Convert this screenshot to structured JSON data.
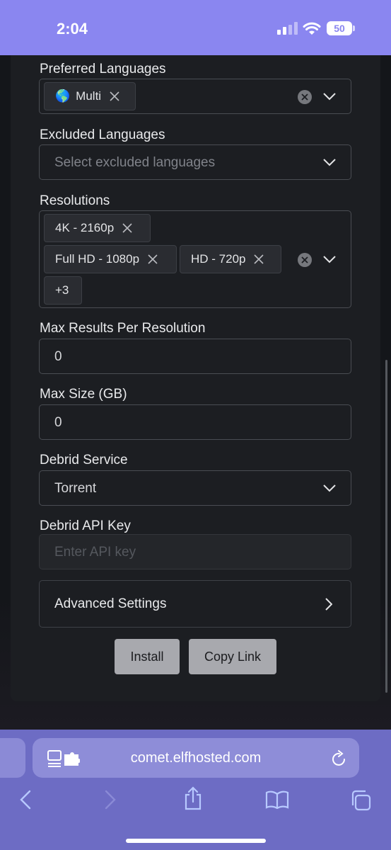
{
  "status_bar": {
    "time": "2:04",
    "battery": "50"
  },
  "form": {
    "preferred_languages": {
      "label": "Preferred Languages",
      "chips": [
        {
          "flag": "🌎",
          "label": "Multi"
        }
      ]
    },
    "excluded_languages": {
      "label": "Excluded Languages",
      "placeholder": "Select excluded languages"
    },
    "resolutions": {
      "label": "Resolutions",
      "chips": [
        "4K - 2160p",
        "Full HD - 1080p",
        "HD - 720p"
      ],
      "more": "+3"
    },
    "max_results": {
      "label": "Max Results Per Resolution",
      "value": "0"
    },
    "max_size": {
      "label": "Max Size (GB)",
      "value": "0"
    },
    "debrid_service": {
      "label": "Debrid Service",
      "value": "Torrent"
    },
    "debrid_api_key": {
      "label": "Debrid API Key",
      "placeholder": "Enter API key"
    },
    "advanced_settings": {
      "label": "Advanced Settings"
    },
    "buttons": {
      "install": "Install",
      "copy_link": "Copy Link"
    }
  },
  "browser": {
    "url": "comet.elfhosted.com"
  },
  "colors": {
    "accent": "#8a86f0",
    "card": "#1c1e22",
    "button": "#a8a9ae"
  }
}
